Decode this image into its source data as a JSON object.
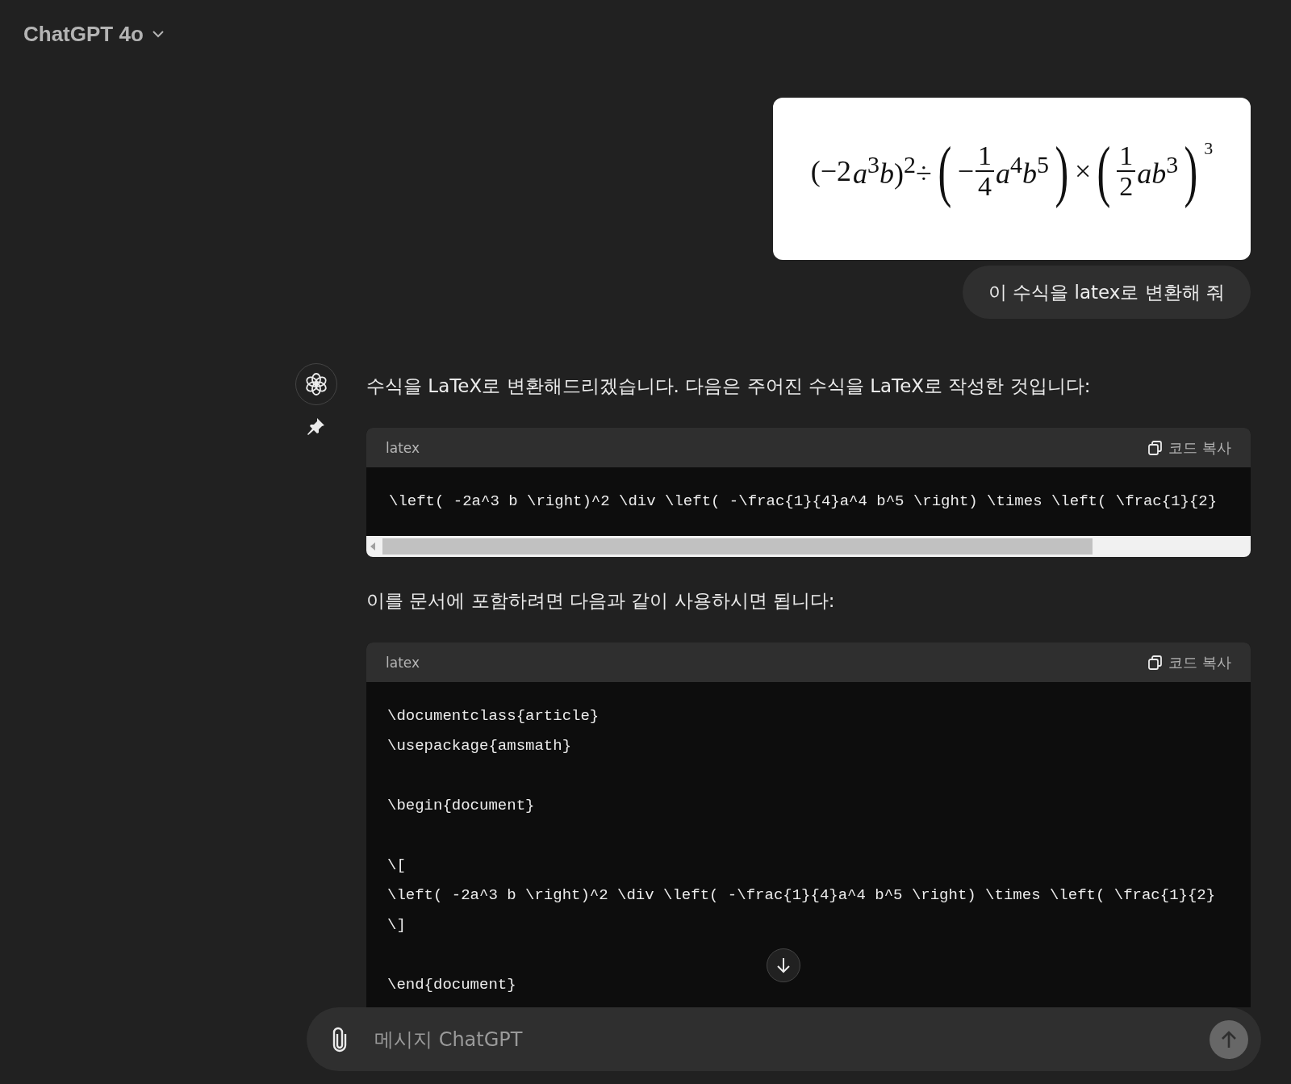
{
  "header": {
    "model": "ChatGPT 4o"
  },
  "user_message": {
    "formula": [
      {
        "kind": "text",
        "text": "(−2"
      },
      {
        "kind": "text",
        "text": "*a*$^{3}$*b*)$^{2}$÷"
      },
      {
        "kind": "paren",
        "text": "("
      },
      {
        "kind": "text",
        "text": "−"
      },
      {
        "kind": "frac",
        "num": "1",
        "den": "4"
      },
      {
        "kind": "text",
        "text": "*a*$^{4}$*b*$^{5}$"
      },
      {
        "kind": "paren",
        "text": ")"
      },
      {
        "kind": "text",
        "text": "×"
      },
      {
        "kind": "paren",
        "text": "("
      },
      {
        "kind": "frac",
        "num": "1",
        "den": "2"
      },
      {
        "kind": "text",
        "text": "*ab*$^{3}$"
      },
      {
        "kind": "paren",
        "text": ")"
      },
      {
        "kind": "high",
        "text": "3"
      }
    ],
    "text": "이 수식을 latex로 변환해 줘"
  },
  "assistant_message": {
    "intro": "수식을 LaTeX로 변환해드리겠습니다. 다음은 주어진 수식을 LaTeX로 작성한 것입니다:",
    "code_blocks": [
      {
        "language": "latex",
        "copy_label": "코드 복사",
        "groups": [
          [
            "\\left( -2a^3 b \\right)^2 \\div \\left( -\\frac{1}{4}a^4 b^5 \\right) \\times \\left( \\frac{1}{2}"
          ]
        ],
        "scrollbar": true
      },
      {
        "language": "latex",
        "copy_label": "코드 복사",
        "groups": [
          [
            "\\documentclass{article}",
            "\\usepackage{amsmath}"
          ],
          [
            "\\begin{document}"
          ],
          [
            "\\[",
            "\\left( -2a^3 b \\right)^2 \\div \\left( -\\frac{1}{4}a^4 b^5 \\right) \\times \\left( \\frac{1}{2}",
            "\\]"
          ],
          [
            "\\end{document}"
          ]
        ],
        "scrollbar": false
      }
    ],
    "middle": "이를 문서에 포함하려면 다음과 같이 사용하시면 됩니다:"
  },
  "composer": {
    "placeholder": "메시지 ChatGPT"
  }
}
